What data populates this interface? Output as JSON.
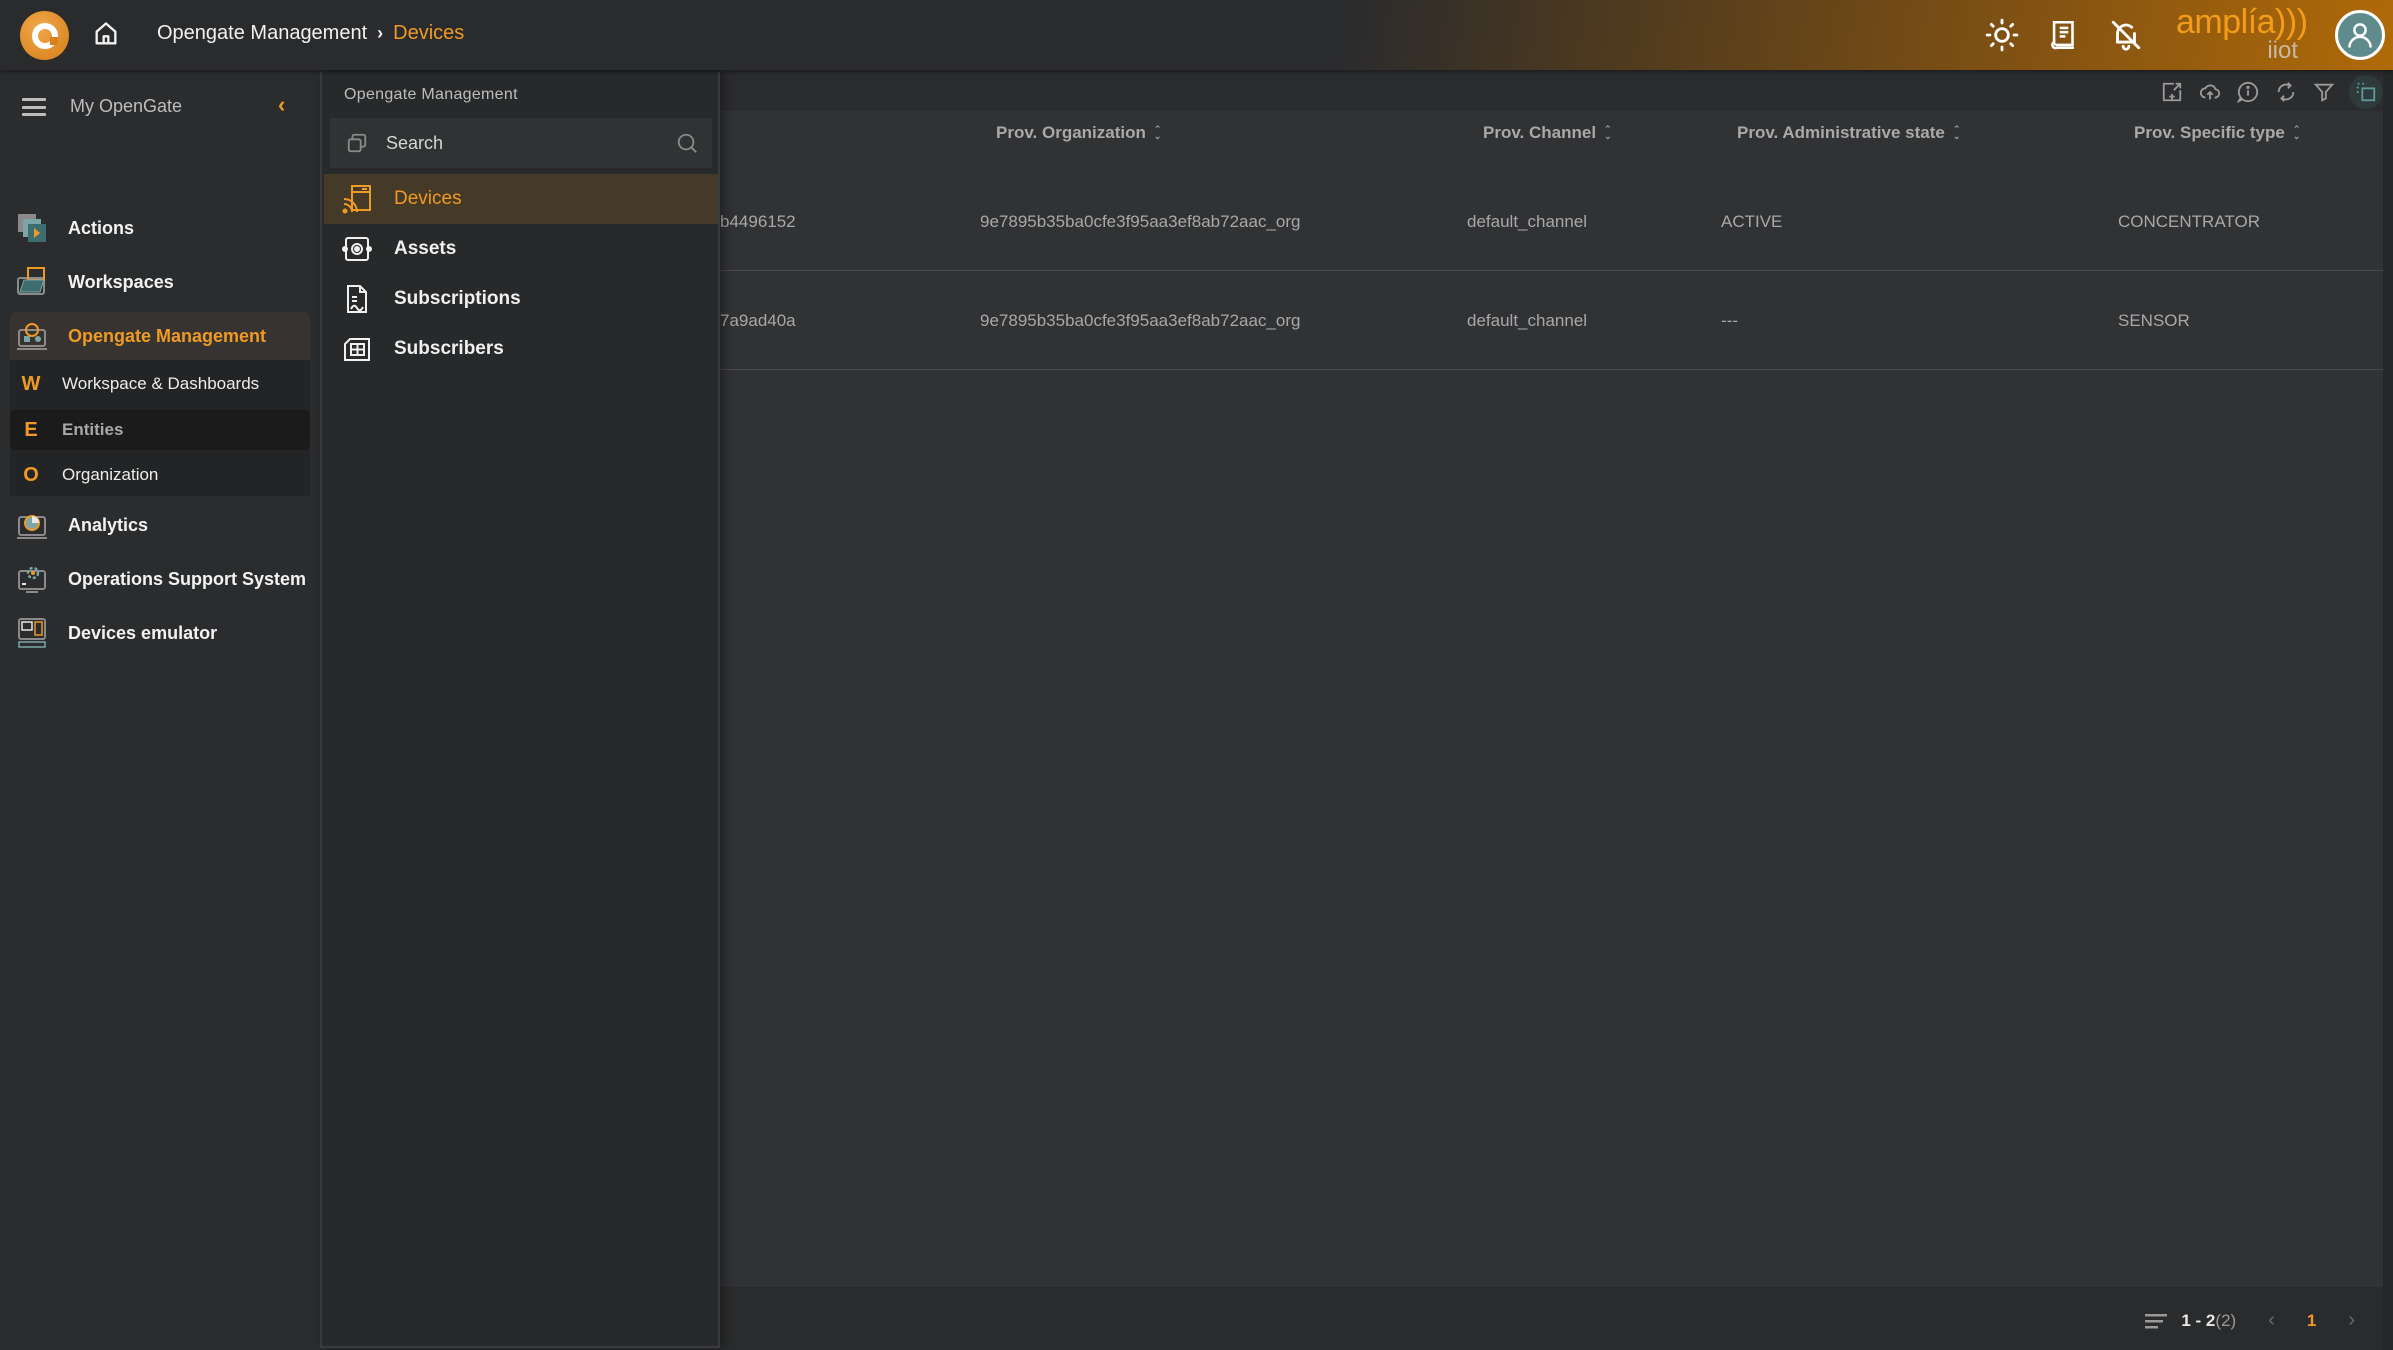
{
  "topbar": {
    "breadcrumb": [
      "Opengate Management",
      "Devices"
    ],
    "breadcrumb_separator": "›",
    "brand_name": "amplía)))",
    "brand_sub": "iiot",
    "icons": [
      "theme-toggle-icon",
      "release-notes-icon",
      "notifications-off-icon",
      "user-avatar-icon"
    ]
  },
  "sidebar": {
    "title": "My OpenGate",
    "items": [
      {
        "label": "Actions",
        "icon": "actions-icon"
      },
      {
        "label": "Workspaces",
        "icon": "workspaces-icon"
      },
      {
        "label": "Opengate Management",
        "icon": "opengate-management-icon",
        "active": true
      },
      {
        "label": "Analytics",
        "icon": "analytics-icon"
      },
      {
        "label": "Operations Support System",
        "icon": "operations-support-icon"
      },
      {
        "label": "Devices emulator",
        "icon": "devices-emulator-icon"
      }
    ],
    "subitems": [
      {
        "letter": "W",
        "label": "Workspace & Dashboards"
      },
      {
        "letter": "E",
        "label": "Entities",
        "selected": true
      },
      {
        "letter": "O",
        "label": "Organization"
      }
    ]
  },
  "flyout": {
    "title": "Opengate Management",
    "search_placeholder": "Search",
    "items": [
      {
        "label": "Devices",
        "icon": "devices-icon",
        "active": true
      },
      {
        "label": "Assets",
        "icon": "assets-icon"
      },
      {
        "label": "Subscriptions",
        "icon": "subscriptions-icon"
      },
      {
        "label": "Subscribers",
        "icon": "subscribers-icon"
      }
    ]
  },
  "toolbar": {
    "icons": [
      "export-icon",
      "upload-icon",
      "info-icon",
      "refresh-icon",
      "filter-icon",
      "select-mode-icon"
    ]
  },
  "table": {
    "columns": [
      "Prov. Organization",
      "Prov. Channel",
      "Prov. Administrative state",
      "Prov. Specific type"
    ],
    "rows": [
      {
        "id_partial": "b4496152",
        "organization": "9e7895b35ba0cfe3f95aa3ef8ab72aac_org",
        "channel": "default_channel",
        "admin_state": "ACTIVE",
        "specific_type": "CONCENTRATOR"
      },
      {
        "id_partial": "7a9ad40a",
        "organization": "9e7895b35ba0cfe3f95aa3ef8ab72aac_org",
        "channel": "default_channel",
        "admin_state": "---",
        "specific_type": "SENSOR"
      }
    ]
  },
  "pagination": {
    "range": "1 - 2",
    "total": "(2)",
    "current_page": "1",
    "prev": "‹",
    "next": "›"
  },
  "colors": {
    "accent": "#f09a26",
    "background": "#2b2c2e",
    "table_bg": "#313234",
    "avatar": "#5f8b8c"
  }
}
